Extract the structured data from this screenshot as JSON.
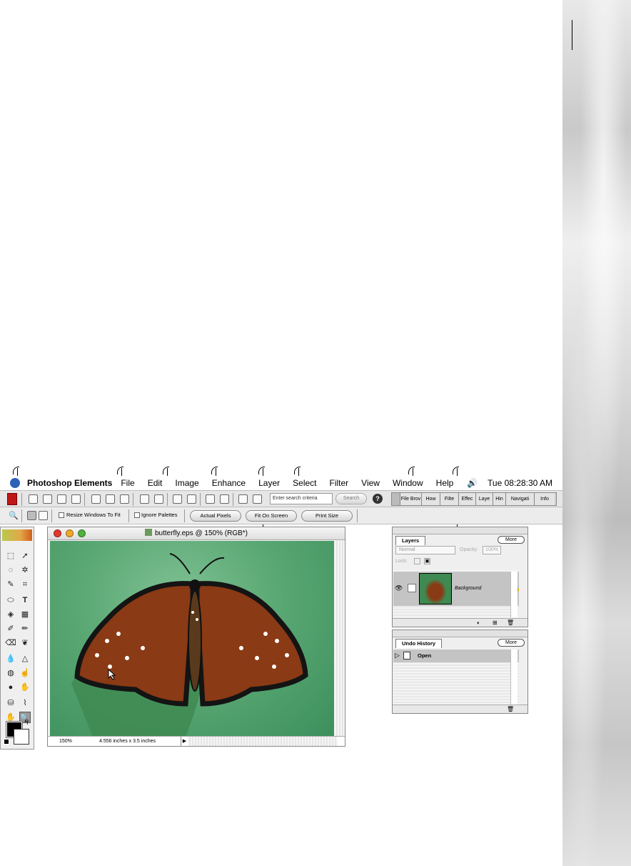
{
  "menubar": {
    "app_name": "Photoshop Elements",
    "items": [
      "File",
      "Edit",
      "Image",
      "Enhance",
      "Layer",
      "Select",
      "Filter",
      "View",
      "Window",
      "Help"
    ],
    "clock": "Tue 08:28:30 AM"
  },
  "shortcuts_bar": {
    "search_placeholder": "Enter search criteria",
    "search_button": "Search",
    "help_button": "?",
    "palette_well": [
      "File Brov",
      "How",
      "Filte",
      "Effec",
      "Laye",
      "Hin",
      "Navigati",
      "Info"
    ]
  },
  "options_bar": {
    "resize_windows": "Resize Windows To Fit",
    "ignore_palettes": "Ignore Palettes",
    "actual_pixels": "Actual Pixels",
    "fit_on_screen": "Fit On Screen",
    "print_size": "Print Size"
  },
  "image_window": {
    "title": "butterfly.eps @ 150% (RGB*)",
    "zoom": "150%",
    "doc_size": "4.556 inches x 3.5 inches"
  },
  "layers_palette": {
    "tab": "Layers",
    "more": "More",
    "blend_mode": "Normal",
    "opacity_label": "Opacity:",
    "opacity_value": "100%",
    "lock_label": "Lock:",
    "layer_name": "Background"
  },
  "history_palette": {
    "tab": "Undo History",
    "more": "More",
    "state": "Open"
  },
  "colors": {
    "apple": "#2c61b8",
    "canvas_green": "#5aa874",
    "wing": "#8a3a14"
  }
}
